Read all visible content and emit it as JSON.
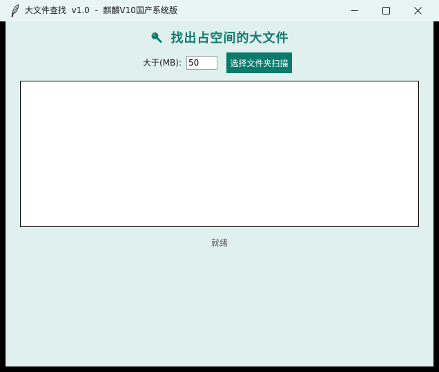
{
  "window": {
    "title": "大文件查找  v1.0  -  麒麟V10国产系统版",
    "icon": "feather-icon",
    "buttons": [
      "minimize-icon",
      "maximize-icon",
      "close-icon"
    ]
  },
  "header": {
    "icon": "magnifier-icon",
    "title": "找出占空间的大文件"
  },
  "controls": {
    "size_label": "大于(MB):",
    "size_value": "50",
    "scan_button_label": "选择文件夹扫描"
  },
  "results": {
    "items": []
  },
  "status": {
    "text": "就绪"
  },
  "colors": {
    "accent": "#0b7a6a",
    "heading": "#127a6c",
    "background": "#dff0ef",
    "titlebar": "#e9f4f5"
  }
}
